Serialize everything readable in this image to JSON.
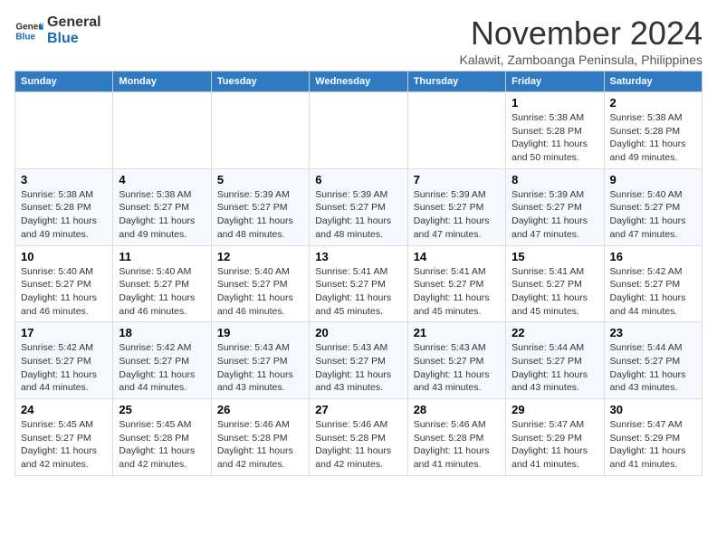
{
  "header": {
    "logo_line1": "General",
    "logo_line2": "Blue",
    "month": "November 2024",
    "location": "Kalawit, Zamboanga Peninsula, Philippines"
  },
  "weekdays": [
    "Sunday",
    "Monday",
    "Tuesday",
    "Wednesday",
    "Thursday",
    "Friday",
    "Saturday"
  ],
  "weeks": [
    [
      {
        "day": "",
        "info": ""
      },
      {
        "day": "",
        "info": ""
      },
      {
        "day": "",
        "info": ""
      },
      {
        "day": "",
        "info": ""
      },
      {
        "day": "",
        "info": ""
      },
      {
        "day": "1",
        "info": "Sunrise: 5:38 AM\nSunset: 5:28 PM\nDaylight: 11 hours\nand 50 minutes."
      },
      {
        "day": "2",
        "info": "Sunrise: 5:38 AM\nSunset: 5:28 PM\nDaylight: 11 hours\nand 49 minutes."
      }
    ],
    [
      {
        "day": "3",
        "info": "Sunrise: 5:38 AM\nSunset: 5:28 PM\nDaylight: 11 hours\nand 49 minutes."
      },
      {
        "day": "4",
        "info": "Sunrise: 5:38 AM\nSunset: 5:27 PM\nDaylight: 11 hours\nand 49 minutes."
      },
      {
        "day": "5",
        "info": "Sunrise: 5:39 AM\nSunset: 5:27 PM\nDaylight: 11 hours\nand 48 minutes."
      },
      {
        "day": "6",
        "info": "Sunrise: 5:39 AM\nSunset: 5:27 PM\nDaylight: 11 hours\nand 48 minutes."
      },
      {
        "day": "7",
        "info": "Sunrise: 5:39 AM\nSunset: 5:27 PM\nDaylight: 11 hours\nand 47 minutes."
      },
      {
        "day": "8",
        "info": "Sunrise: 5:39 AM\nSunset: 5:27 PM\nDaylight: 11 hours\nand 47 minutes."
      },
      {
        "day": "9",
        "info": "Sunrise: 5:40 AM\nSunset: 5:27 PM\nDaylight: 11 hours\nand 47 minutes."
      }
    ],
    [
      {
        "day": "10",
        "info": "Sunrise: 5:40 AM\nSunset: 5:27 PM\nDaylight: 11 hours\nand 46 minutes."
      },
      {
        "day": "11",
        "info": "Sunrise: 5:40 AM\nSunset: 5:27 PM\nDaylight: 11 hours\nand 46 minutes."
      },
      {
        "day": "12",
        "info": "Sunrise: 5:40 AM\nSunset: 5:27 PM\nDaylight: 11 hours\nand 46 minutes."
      },
      {
        "day": "13",
        "info": "Sunrise: 5:41 AM\nSunset: 5:27 PM\nDaylight: 11 hours\nand 45 minutes."
      },
      {
        "day": "14",
        "info": "Sunrise: 5:41 AM\nSunset: 5:27 PM\nDaylight: 11 hours\nand 45 minutes."
      },
      {
        "day": "15",
        "info": "Sunrise: 5:41 AM\nSunset: 5:27 PM\nDaylight: 11 hours\nand 45 minutes."
      },
      {
        "day": "16",
        "info": "Sunrise: 5:42 AM\nSunset: 5:27 PM\nDaylight: 11 hours\nand 44 minutes."
      }
    ],
    [
      {
        "day": "17",
        "info": "Sunrise: 5:42 AM\nSunset: 5:27 PM\nDaylight: 11 hours\nand 44 minutes."
      },
      {
        "day": "18",
        "info": "Sunrise: 5:42 AM\nSunset: 5:27 PM\nDaylight: 11 hours\nand 44 minutes."
      },
      {
        "day": "19",
        "info": "Sunrise: 5:43 AM\nSunset: 5:27 PM\nDaylight: 11 hours\nand 43 minutes."
      },
      {
        "day": "20",
        "info": "Sunrise: 5:43 AM\nSunset: 5:27 PM\nDaylight: 11 hours\nand 43 minutes."
      },
      {
        "day": "21",
        "info": "Sunrise: 5:43 AM\nSunset: 5:27 PM\nDaylight: 11 hours\nand 43 minutes."
      },
      {
        "day": "22",
        "info": "Sunrise: 5:44 AM\nSunset: 5:27 PM\nDaylight: 11 hours\nand 43 minutes."
      },
      {
        "day": "23",
        "info": "Sunrise: 5:44 AM\nSunset: 5:27 PM\nDaylight: 11 hours\nand 43 minutes."
      }
    ],
    [
      {
        "day": "24",
        "info": "Sunrise: 5:45 AM\nSunset: 5:27 PM\nDaylight: 11 hours\nand 42 minutes."
      },
      {
        "day": "25",
        "info": "Sunrise: 5:45 AM\nSunset: 5:28 PM\nDaylight: 11 hours\nand 42 minutes."
      },
      {
        "day": "26",
        "info": "Sunrise: 5:46 AM\nSunset: 5:28 PM\nDaylight: 11 hours\nand 42 minutes."
      },
      {
        "day": "27",
        "info": "Sunrise: 5:46 AM\nSunset: 5:28 PM\nDaylight: 11 hours\nand 42 minutes."
      },
      {
        "day": "28",
        "info": "Sunrise: 5:46 AM\nSunset: 5:28 PM\nDaylight: 11 hours\nand 41 minutes."
      },
      {
        "day": "29",
        "info": "Sunrise: 5:47 AM\nSunset: 5:29 PM\nDaylight: 11 hours\nand 41 minutes."
      },
      {
        "day": "30",
        "info": "Sunrise: 5:47 AM\nSunset: 5:29 PM\nDaylight: 11 hours\nand 41 minutes."
      }
    ]
  ]
}
